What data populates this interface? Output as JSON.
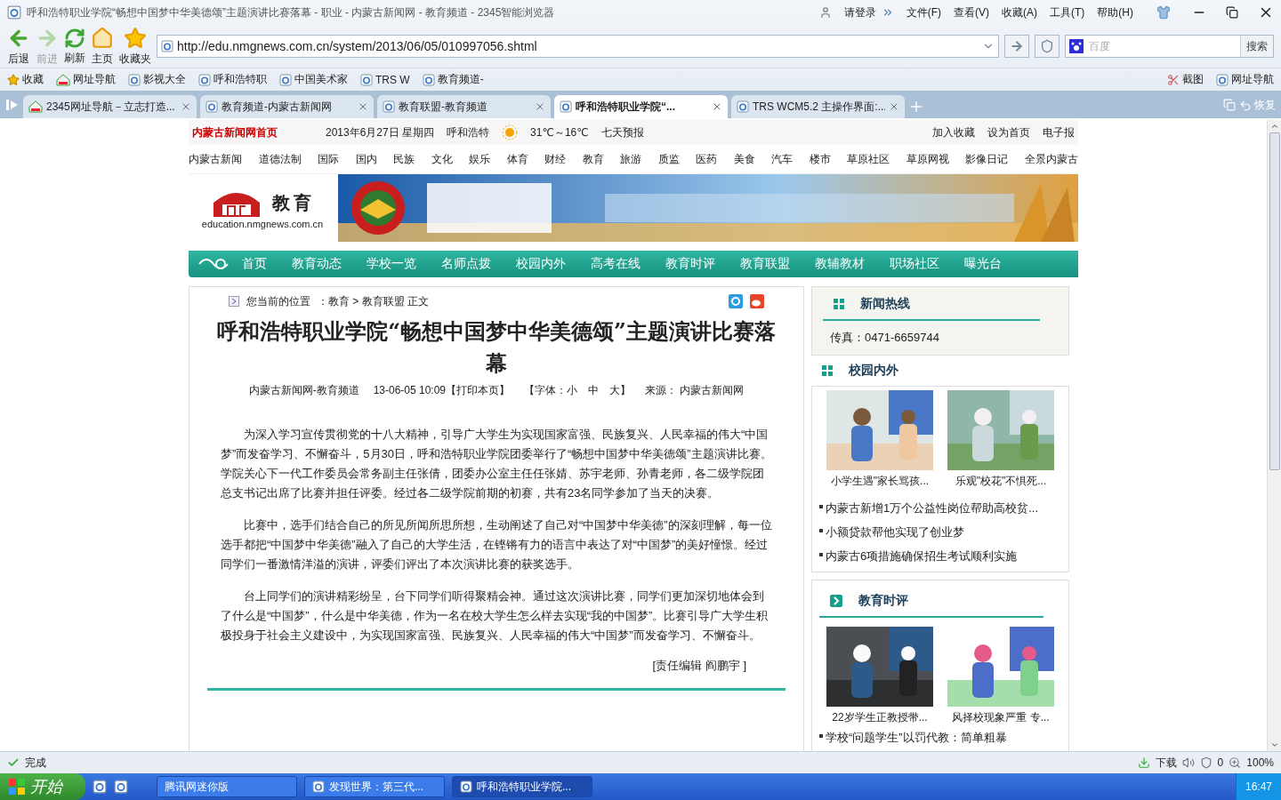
{
  "window": {
    "title": "呼和浩特职业学院“畅想中国梦中华美德颂”主题演讲比赛落幕 - 职业 - 内蒙古新闻网 - 教育频道 - 2345智能浏览器"
  },
  "menu": {
    "login": "请登录",
    "items": [
      "文件(F)",
      "查看(V)",
      "收藏(A)",
      "工具(T)",
      "帮助(H)"
    ]
  },
  "toolbar": {
    "buttons": [
      {
        "kind": "back",
        "label": "后退",
        "disabled": false
      },
      {
        "kind": "forward",
        "label": "前进",
        "disabled": true
      },
      {
        "kind": "refresh",
        "label": "刷新",
        "disabled": false
      },
      {
        "kind": "home",
        "label": "主页",
        "disabled": false
      },
      {
        "kind": "favorites",
        "label": "收藏夹",
        "disabled": false
      }
    ]
  },
  "address": {
    "value": "http://edu.nmgnews.com.cn/system/2013/06/05/010997056.shtml"
  },
  "search": {
    "placeholder": "百度",
    "button": "搜索"
  },
  "bookmarks": {
    "items": [
      {
        "kind": "star",
        "label": "收藏"
      },
      {
        "kind": "nav",
        "label": "网址导航"
      },
      {
        "kind": "page",
        "label": "影视大全"
      },
      {
        "kind": "page",
        "label": "呼和浩特职"
      },
      {
        "kind": "page",
        "label": "中国美术家"
      },
      {
        "kind": "page",
        "label": "TRS W"
      },
      {
        "kind": "page",
        "label": "教育频道-"
      }
    ],
    "right": [
      "截图",
      "网址导航"
    ]
  },
  "tabs": [
    {
      "kind": "nav",
      "label": "2345网址导航－立志打造...",
      "selected": false
    },
    {
      "kind": "page",
      "label": "教育频道-内蒙古新闻网",
      "selected": false
    },
    {
      "kind": "page",
      "label": "教育联盟-教育频道",
      "selected": false
    },
    {
      "kind": "page",
      "label": "呼和浩特职业学院“...",
      "selected": true
    },
    {
      "kind": "page",
      "label": "TRS WCM5.2 主操作界面:...",
      "selected": false
    }
  ],
  "restore": "恢复",
  "page": {
    "header": {
      "home": "内蒙古新闻网首页",
      "date": "2013年6月27日  星期四",
      "city": "呼和浩特",
      "temp": "31℃～16℃",
      "forecast": "七天预报",
      "links": [
        "加入收藏",
        "设为首页",
        "电子报"
      ]
    },
    "channels": [
      "内蒙古新闻",
      "道德法制",
      "国际",
      "国内",
      "民族",
      "文化",
      "娱乐",
      "体育",
      "财经",
      "教育",
      "旅游",
      "质监",
      "医药",
      "美食",
      "汽车",
      "楼市",
      "草原社区",
      "草原网视",
      "影像日记",
      "全景内蒙古"
    ],
    "logo": {
      "title": "教育",
      "domain": "education.nmgnews.com.cn"
    },
    "nav": [
      "首页",
      "教育动态",
      "学校一览",
      "名师点拨",
      "校园内外",
      "高考在线",
      "教育时评",
      "教育联盟",
      "教辅教材",
      "职场社区",
      "曝光台"
    ],
    "breadcrumb": {
      "label": "您当前的位置",
      "path": "：教育 > 教育联盟 正文"
    },
    "article": {
      "title": "呼和浩特职业学院“畅想中国梦中华美德颂”主题演讲比赛落幕",
      "meta": [
        "内蒙古新闻网-教育频道",
        "13-06-05 10:09【打印本页】",
        "【字体：小　中　大】",
        "来源：  内蒙古新闻网"
      ],
      "paragraphs": [
        "为深入学习宣传贯彻党的十八大精神，引导广大学生为实现国家富强、民族复兴、人民幸福的伟大“中国梦”而发奋学习、不懈奋斗，5月30日，呼和浩特职业学院团委举行了“畅想中国梦中华美德颂”主题演讲比赛。学院关心下一代工作委员会常务副主任张倩，团委办公室主任任张婧、苏宇老师、孙青老师，各二级学院团总支书记出席了比赛并担任评委。经过各二级学院前期的初赛，共有23名同学参加了当天的决赛。",
        "比赛中，选手们结合自己的所见所闻所思所想，生动阐述了自己对“中国梦中华美德”的深刻理解，每一位选手都把“中国梦中华美德”融入了自己的大学生活，在铿锵有力的语言中表达了对“中国梦”的美好憧憬。经过同学们一番激情洋溢的演讲，评委们评出了本次演讲比赛的获奖选手。",
        "台上同学们的演讲精彩纷呈，台下同学们听得聚精会神。通过这次演讲比赛，同学们更加深切地体会到了什么是“中国梦”，什么是中华美德，作为一名在校大学生怎么样去实现“我的中国梦”。比赛引导广大学生积极投身于社会主义建设中，为实现国家富强、民族复兴、人民幸福的伟大“中国梦”而发奋学习、不懈奋斗。"
      ],
      "editor": "[责任编辑  阎鹏宇 ]"
    },
    "sidebar": {
      "hotline": {
        "title": "新闻热线",
        "text": "传真：0471-6659744"
      },
      "campus": {
        "title": "校园内外",
        "photos": [
          "小学生遇\"家长骂孩...",
          "乐观\"校花\"不惧死..."
        ],
        "links": [
          "内蒙古新增1万个公益性岗位帮助高校贫...",
          "小额贷款帮他实现了创业梦",
          "内蒙古6项措施确保招生考试顺利实施"
        ]
      },
      "commentary": {
        "title": "教育时评",
        "photos": [
          "22岁学生正教授带...",
          "风择校现象严重  专..."
        ],
        "links": [
          "学校“问题学生”以罚代教：简单粗暴"
        ]
      }
    }
  },
  "status_bar": {
    "text": "完成",
    "download": "下载",
    "count": "0",
    "zoom": "100%"
  },
  "taskbar": {
    "start": "开始",
    "tasks": [
      {
        "label": "腾讯网迷你版",
        "selected": false
      },
      {
        "label": "发现世界：第三代...",
        "selected": false
      },
      {
        "label": "呼和浩特职业学院...",
        "selected": true
      }
    ],
    "clock": "16:47"
  }
}
